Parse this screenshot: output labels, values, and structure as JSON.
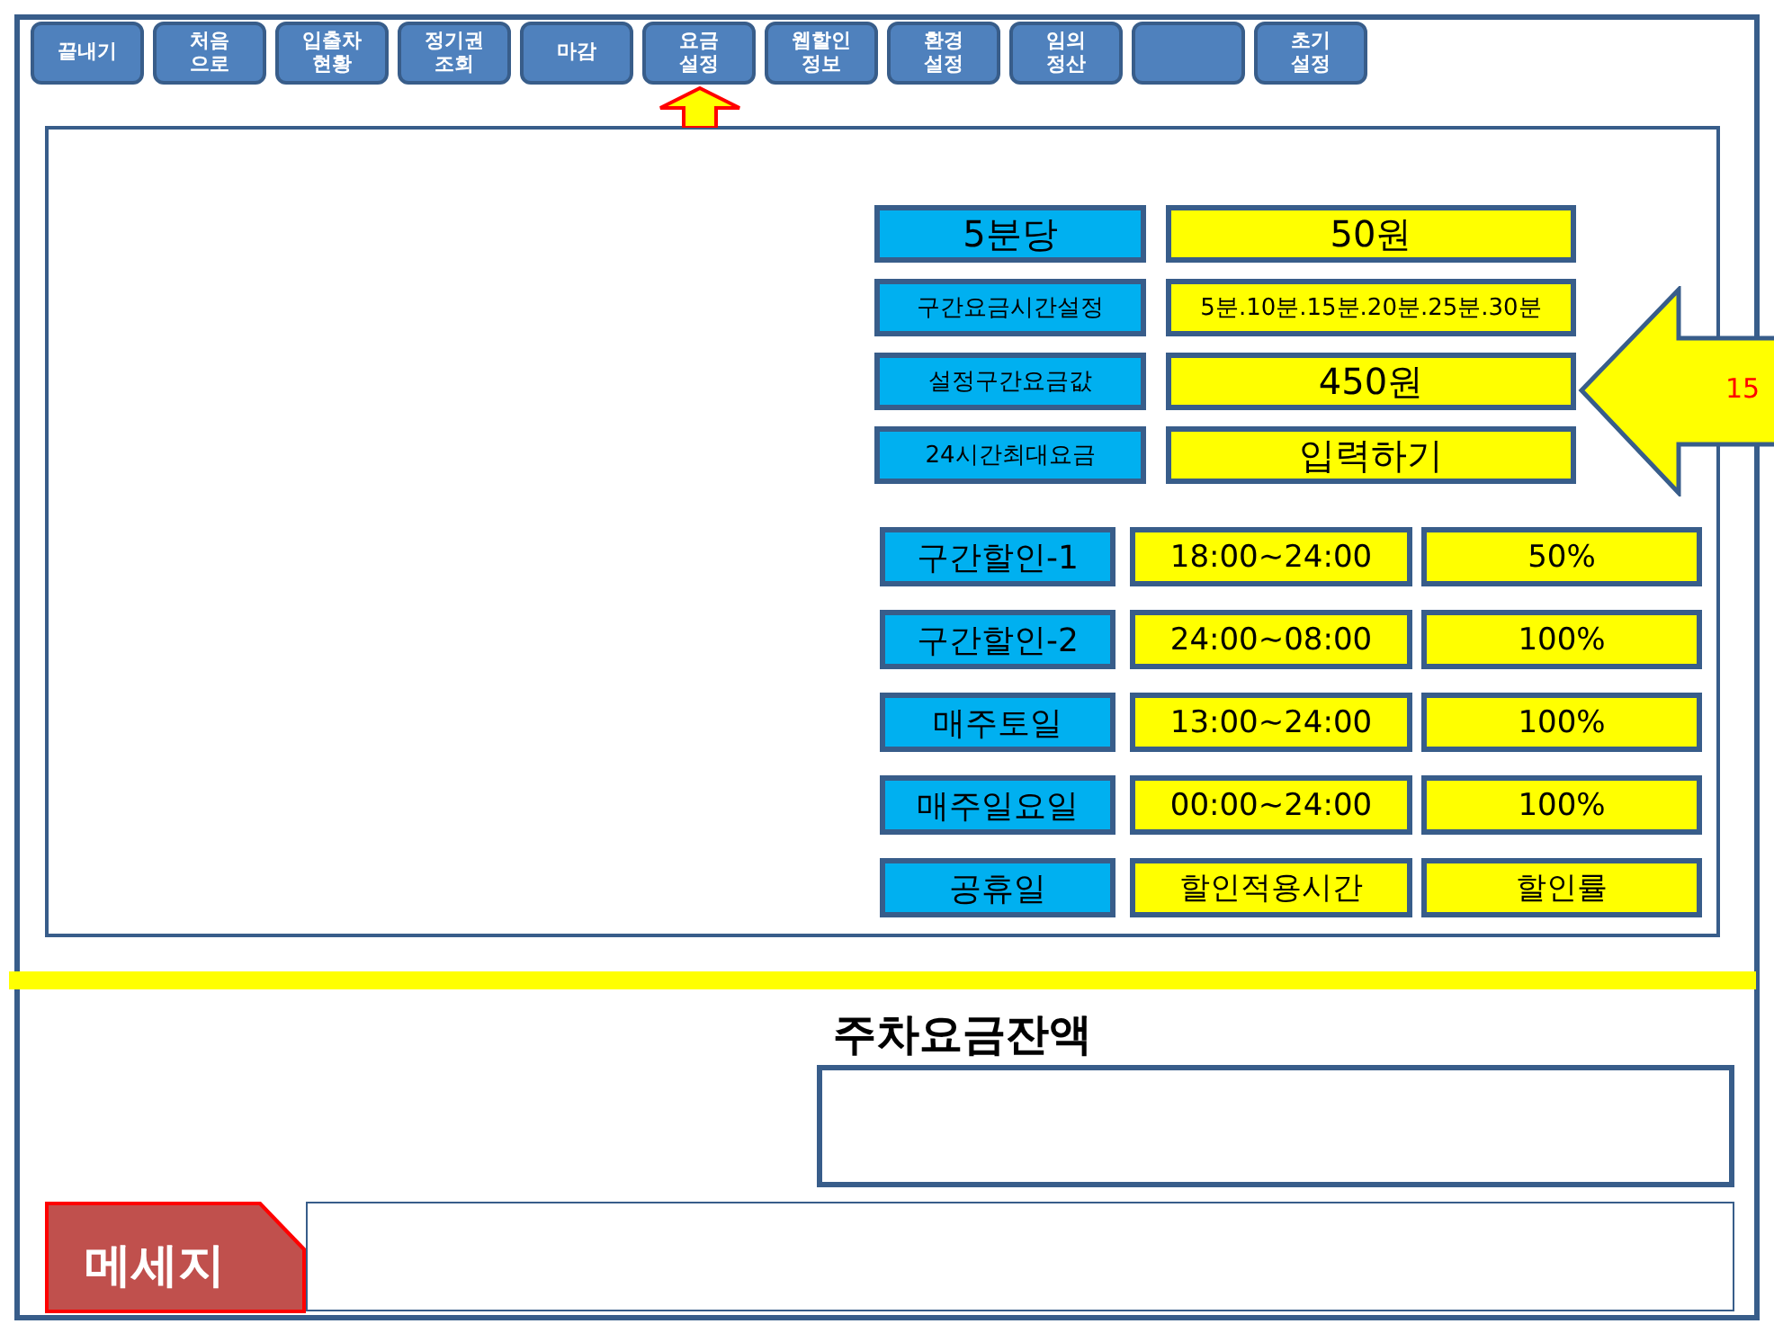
{
  "toolbar": {
    "buttons": [
      {
        "kind": "labeled",
        "label": "끝내기"
      },
      {
        "kind": "labeled",
        "label": "처음\n으로"
      },
      {
        "kind": "labeled",
        "label": "입출차\n현황"
      },
      {
        "kind": "labeled",
        "label": "정기권\n조회"
      },
      {
        "kind": "labeled",
        "label": "마감"
      },
      {
        "kind": "labeled",
        "label": "요금\n설정"
      },
      {
        "kind": "labeled",
        "label": "웹할인\n정보"
      },
      {
        "kind": "labeled",
        "label": "환경\n설정"
      },
      {
        "kind": "labeled",
        "label": "임의\n정산"
      },
      {
        "kind": "blank"
      },
      {
        "kind": "labeled",
        "label": "초기\n설정"
      }
    ]
  },
  "fee_settings": [
    {
      "label": "5분당",
      "value": "50원"
    },
    {
      "label": "구간요금시간설정",
      "value": "5분.10분.15분.20분.25분.30분"
    },
    {
      "label": "설정구간요금값",
      "value": "450원"
    },
    {
      "label": "24시간최대요금",
      "value": "입력하기"
    }
  ],
  "callout": {
    "text": "15"
  },
  "discounts": [
    {
      "name": "구간할인-1",
      "time": "18:00~24:00",
      "rate": "50%"
    },
    {
      "name": "구간할인-2",
      "time": "24:00~08:00",
      "rate": "100%"
    },
    {
      "name": "매주토일",
      "time": "13:00~24:00",
      "rate": "100%"
    },
    {
      "name": "매주일요일",
      "time": "00:00~24:00",
      "rate": "100%"
    },
    {
      "name": "공휴일",
      "time": "할인적용시간",
      "rate": "할인률"
    }
  ],
  "balance": {
    "title": "주차요금잔액"
  },
  "message": {
    "label": "메세지"
  }
}
